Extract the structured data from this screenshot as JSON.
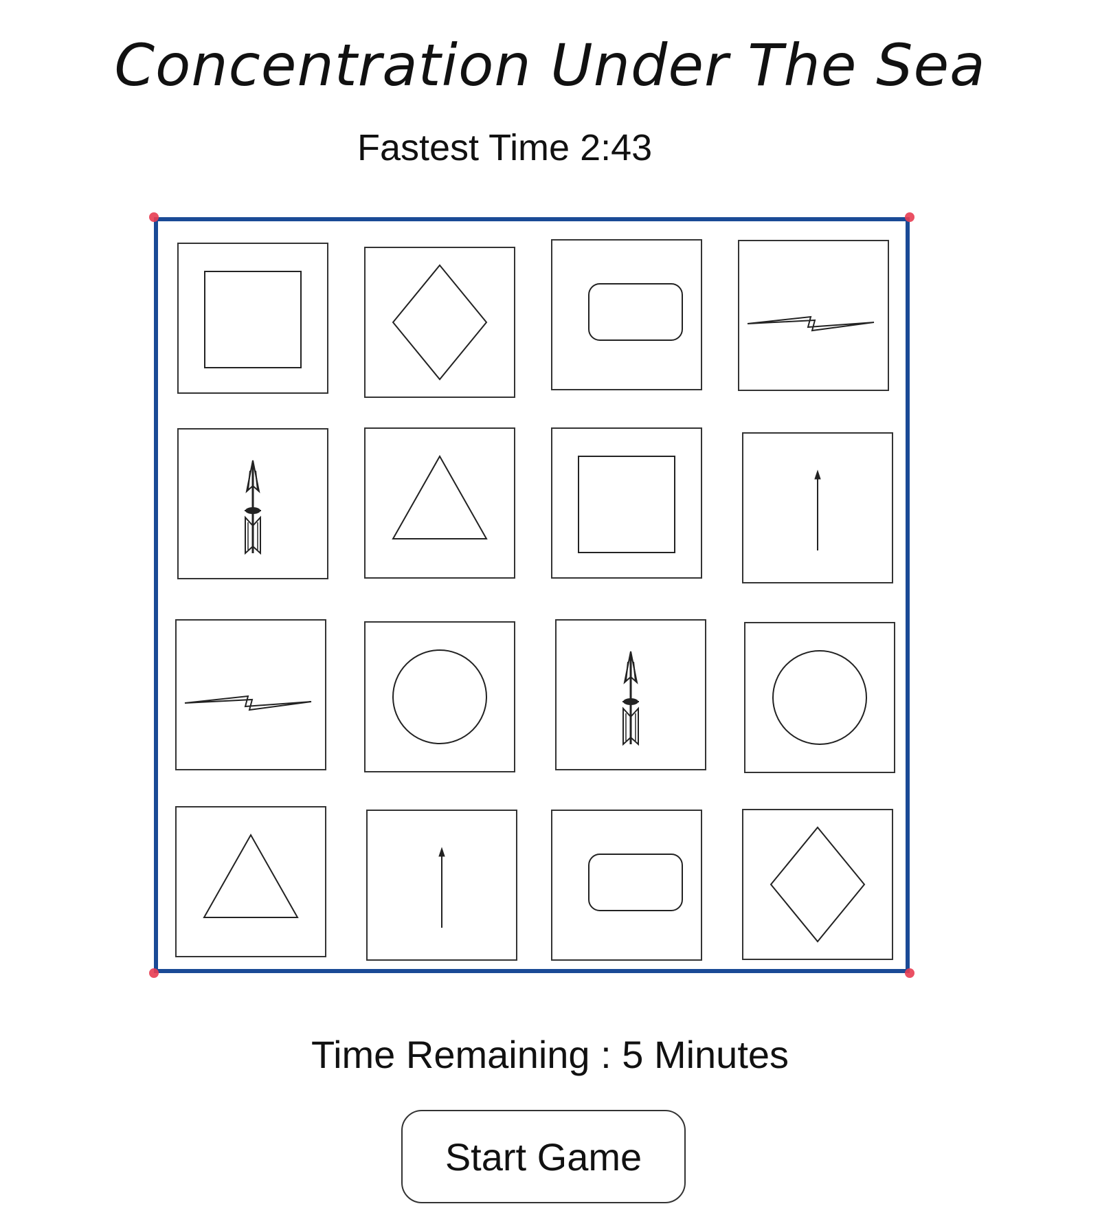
{
  "game": {
    "title": "Concentration Under The Sea",
    "fastest_time": "Fastest Time 2:43",
    "time_remaining": "Time Remaining : 5 Minutes",
    "start_button_label": "Start Game",
    "board_border_color": "#1a4a96",
    "corner_marker_color": "#e83d52"
  },
  "board": {
    "cards": [
      {
        "symbol": "square"
      },
      {
        "symbol": "diamond"
      },
      {
        "symbol": "rounded-rectangle"
      },
      {
        "symbol": "lightning-bolt"
      },
      {
        "symbol": "feathered-arrow"
      },
      {
        "symbol": "triangle"
      },
      {
        "symbol": "square"
      },
      {
        "symbol": "thin-arrow"
      },
      {
        "symbol": "lightning-bolt"
      },
      {
        "symbol": "circle"
      },
      {
        "symbol": "feathered-arrow"
      },
      {
        "symbol": "circle"
      },
      {
        "symbol": "triangle"
      },
      {
        "symbol": "thin-arrow"
      },
      {
        "symbol": "rounded-rectangle"
      },
      {
        "symbol": "diamond"
      }
    ]
  }
}
